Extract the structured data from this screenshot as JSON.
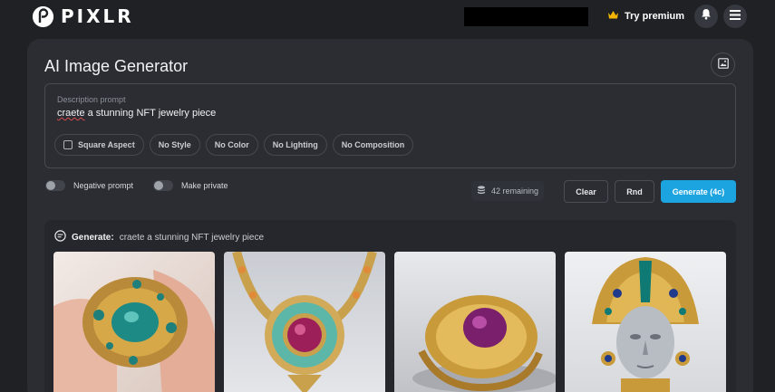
{
  "brand": {
    "name": "PIXLR"
  },
  "header": {
    "premium_label": "Try premium"
  },
  "page": {
    "title": "AI Image Generator"
  },
  "prompt": {
    "label": "Description prompt",
    "value_prefix": "craete",
    "value_rest": " a stunning NFT jewelry piece"
  },
  "options": {
    "chips": [
      "Square Aspect",
      "No Style",
      "No Color",
      "No Lighting",
      "No Composition"
    ]
  },
  "toggles": {
    "negative_prompt": "Negative prompt",
    "make_private": "Make private"
  },
  "credits": {
    "remaining": "42 remaining"
  },
  "actions": {
    "clear": "Clear",
    "rnd": "Rnd",
    "generate": "Generate (4c)"
  },
  "results": {
    "generate_label": "Generate:",
    "generate_prompt": "craete a stunning NFT jewelry piece",
    "images": [
      {
        "name": "generated-image-ring-hand"
      },
      {
        "name": "generated-image-necklace"
      },
      {
        "name": "generated-image-ring-gold"
      },
      {
        "name": "generated-image-mask"
      }
    ]
  },
  "colors": {
    "accent": "#1ba4e0",
    "background": "#1f2125",
    "panel": "#2b2d33",
    "crown": "#f4b400"
  },
  "icons": [
    "pixlr-logo-icon",
    "crown-icon",
    "bell-icon",
    "menu-icon",
    "image-icon",
    "credits-icon",
    "generate-icon"
  ]
}
